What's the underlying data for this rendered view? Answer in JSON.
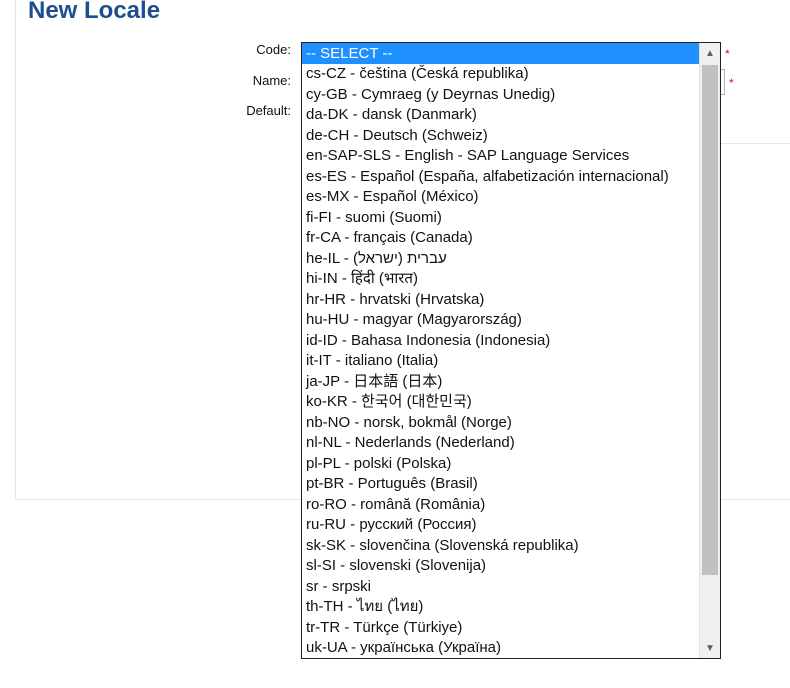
{
  "page": {
    "title": "New Locale"
  },
  "form": {
    "code_label": "Code:",
    "name_label": "Name:",
    "default_label": "Default:",
    "required_marker": "*"
  },
  "dropdown": {
    "options": [
      "-- SELECT --",
      "cs-CZ - čeština (Česká republika)",
      "cy-GB - Cymraeg (y Deyrnas Unedig)",
      "da-DK - dansk (Danmark)",
      "de-CH - Deutsch (Schweiz)",
      "en-SAP-SLS - English - SAP Language Services",
      "es-ES - Español (España, alfabetización internacional)",
      "es-MX - Español (México)",
      "fi-FI - suomi (Suomi)",
      "fr-CA - français (Canada)",
      "he-IL - עברית (ישראל)",
      "hi-IN - हिंदी (भारत)",
      "hr-HR - hrvatski (Hrvatska)",
      "hu-HU - magyar (Magyarország)",
      "id-ID - Bahasa Indonesia (Indonesia)",
      "it-IT - italiano (Italia)",
      "ja-JP - 日本語 (日本)",
      "ko-KR - 한국어 (대한민국)",
      "nb-NO - norsk, bokmål (Norge)",
      "nl-NL - Nederlands (Nederland)",
      "pl-PL - polski (Polska)",
      "pt-BR - Português (Brasil)",
      "ro-RO - română (România)",
      "ru-RU - русский (Россия)",
      "sk-SK - slovenčina (Slovenská republika)",
      "sl-SI - slovenski (Slovenija)",
      "sr - srpski",
      "th-TH - ไทย (ไทย)",
      "tr-TR - Türkçe (Türkiye)",
      "uk-UA - українська (Україна)"
    ],
    "selected_index": 0
  },
  "icons": {
    "scroll_up": "chevron-up-icon",
    "scroll_down": "chevron-down-icon"
  },
  "colors": {
    "title": "#1f4e8c",
    "selected_option_bg": "#1e90ff",
    "required": "#d01818"
  }
}
